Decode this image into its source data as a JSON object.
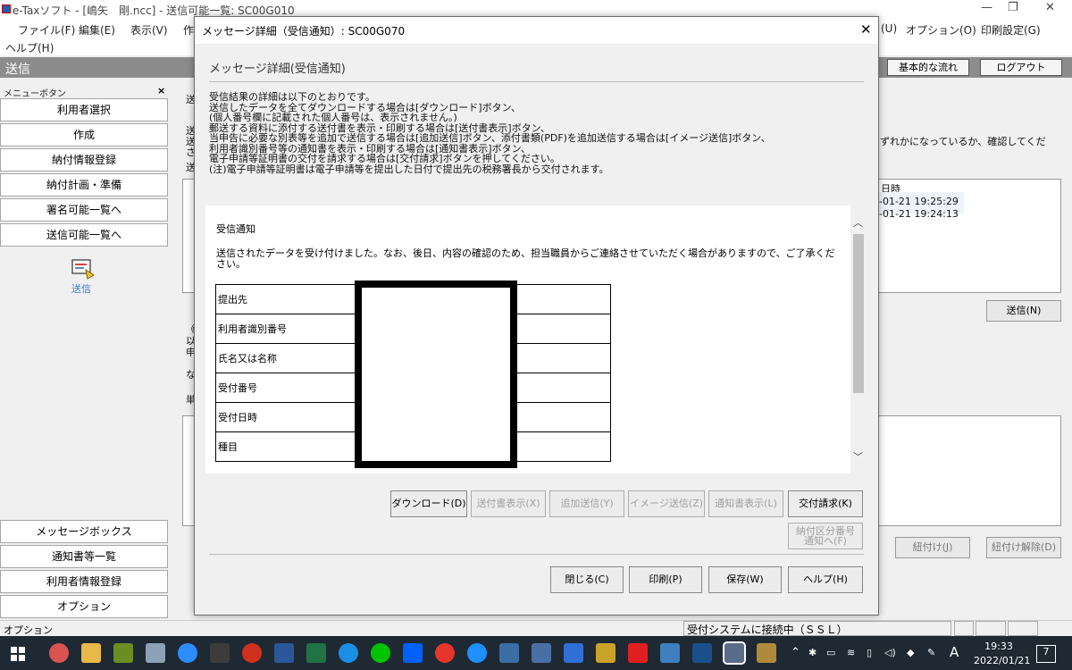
{
  "window": {
    "title": "e-Taxソフト - [嶋矢　剛.ncc] - 送信可能一覧: SC00G010",
    "menu": [
      "ファイル(F)",
      "編集(E)",
      "表示(V)",
      "作",
      "(U)",
      "オプション(O)",
      "印刷設定(G)"
    ],
    "menu_help": "ヘルプ(H)",
    "controls": {
      "minimize": "—",
      "restore": "❐",
      "close": "✕"
    }
  },
  "send_bar": {
    "title": "送信",
    "basic_flow": "基本的な流れ",
    "logout": "ログアウト"
  },
  "left_menu": {
    "header": "メニューボタン",
    "close": "×",
    "top_items": [
      "利用者選択",
      "作成",
      "納付情報登録",
      "納付計画・準備",
      "署名可能一覧へ",
      "送信可能一覧へ"
    ],
    "send_label": "送信",
    "bottom_items": [
      "メッセージボックス",
      "通知書等一覧",
      "利用者情報登録",
      "オプション"
    ]
  },
  "background": {
    "fragments": [
      "送",
      "送",
      "送",
      "さ",
      "送"
    ],
    "right_text": "ずれかになっているか、確認してくだ",
    "col_header": "日時",
    "rows": [
      "-01-21 19:25:29",
      "-01-21 19:24:13"
    ],
    "send_button": "送信(N)",
    "link_button": "紐付け(J)",
    "unlink_button": "紐付け解除(D)",
    "left_chars": [
      "《",
      "以",
      "申",
      "な",
      "単"
    ]
  },
  "status": {
    "left": "オプション",
    "connection": "受付システムに接続中（ＳＳＬ）"
  },
  "taskbar": {
    "time": "19:33",
    "date": "2022/01/21",
    "ime": "A",
    "notify_count": "7"
  },
  "dialog": {
    "title": "メッセージ詳細（受信通知）: SC00G070",
    "close": "✕",
    "heading": "メッセージ詳細(受信通知)",
    "intro": [
      "受信結果の詳細は以下のとおりです。",
      "送信したデータを全てダウンロードする場合は[ダウンロード]ボタン、",
      "(個人番号欄に記載された個人番号は、表示されません。)",
      "郵送する資料に添付する送付書を表示・印刷する場合は[送付書表示]ボタン、",
      "当申告に必要な別表等を追加で送信する場合は[追加送信]ボタン、添付書類(PDF)を追加送信する場合は[イメージ送信]ボタン、",
      "利用者識別番号等の通知書を表示・印刷する場合は[通知書表示]ボタン、",
      "電子申請等証明書の交付を請求する場合は[交付請求]ボタンを押してください。",
      "(注)電子申請等証明書は電子申請等を提出した日付で提出先の税務署長から交付されます。"
    ],
    "content": {
      "title": "受信通知",
      "message": "送信されたデータを受け付けました。なお、後日、内容の確認のため、担当職員からご連絡させていただく場合がありますので、ご了承ください。",
      "fields": [
        "提出先",
        "利用者識別番号",
        "氏名又は名称",
        "受付番号",
        "受付日時",
        "種目"
      ]
    },
    "buttons": {
      "download": "ダウンロード(D)",
      "cover_sheet": "送付書表示(X)",
      "additional": "追加送信(Y)",
      "image_send": "イメージ送信(Z)",
      "notice": "通知書表示(L)",
      "issue_request": "交付請求(K)",
      "payment_code_1": "納付区分番号",
      "payment_code_2": "通知へ(F)",
      "close": "閉じる(C)",
      "print": "印刷(P)",
      "save": "保存(W)",
      "help": "ヘルプ(H)"
    }
  }
}
